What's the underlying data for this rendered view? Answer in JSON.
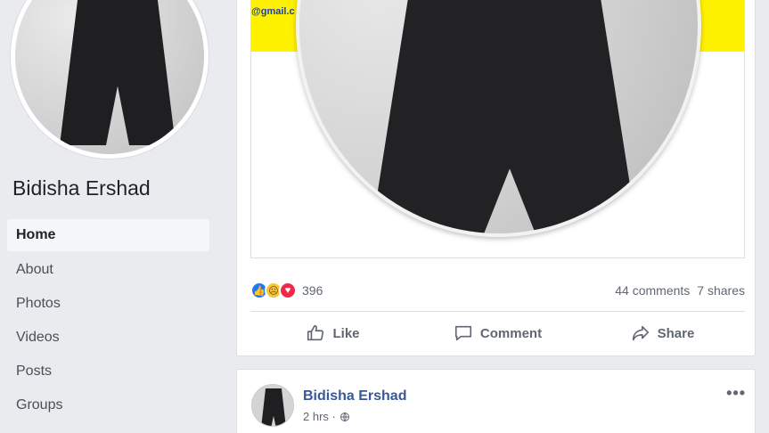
{
  "sidebar": {
    "profile_name": "Bidisha Ershad",
    "nav": [
      "Home",
      "About",
      "Photos",
      "Videos",
      "Posts",
      "Groups"
    ]
  },
  "post": {
    "email_fragment": "@gmail.c",
    "reaction_count": "396",
    "comments": "44 comments",
    "shares": "7 shares",
    "actions": {
      "like": "Like",
      "comment": "Comment",
      "share": "Share"
    }
  },
  "next_post": {
    "author": "Bidisha Ershad",
    "time": "2 hrs ·",
    "more": "•••"
  },
  "colors": {
    "accent": "#385898",
    "like": "#2078f4",
    "love": "#f0284a",
    "sad": "#f7c43a",
    "banner": "#fff200"
  },
  "icons": [
    "like-icon",
    "sad-icon",
    "love-icon",
    "thumbs-up-icon",
    "comment-icon",
    "share-icon",
    "globe-icon",
    "more-icon"
  ]
}
